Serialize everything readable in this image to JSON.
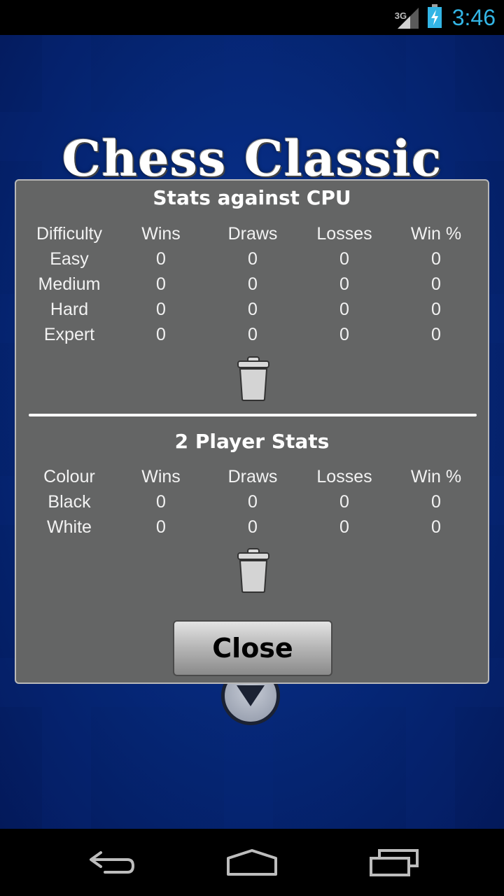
{
  "status_bar": {
    "network_type": "3G",
    "time": "3:46",
    "icons": [
      "signal-icon",
      "battery-charging-icon"
    ]
  },
  "app": {
    "title": "Chess Classic",
    "down_button_icon": "arrow-down-icon"
  },
  "dialog": {
    "cpu_section": {
      "title": "Stats against CPU",
      "headers": [
        "Difficulty",
        "Wins",
        "Draws",
        "Losses",
        "Win %"
      ],
      "rows": [
        [
          "Easy",
          "0",
          "0",
          "0",
          "0"
        ],
        [
          "Medium",
          "0",
          "0",
          "0",
          "0"
        ],
        [
          "Hard",
          "0",
          "0",
          "0",
          "0"
        ],
        [
          "Expert",
          "0",
          "0",
          "0",
          "0"
        ]
      ],
      "clear_icon": "trash-icon"
    },
    "two_player_section": {
      "title": "2 Player Stats",
      "headers": [
        "Colour",
        "Wins",
        "Draws",
        "Losses",
        "Win %"
      ],
      "rows": [
        [
          "Black",
          "0",
          "0",
          "0",
          "0"
        ],
        [
          "White",
          "0",
          "0",
          "0",
          "0"
        ]
      ],
      "clear_icon": "trash-icon"
    },
    "close_label": "Close"
  },
  "nav_bar": {
    "icons": [
      "back-icon",
      "home-icon",
      "recent-apps-icon"
    ]
  },
  "colors": {
    "clock": "#33b5e5",
    "dialog_bg": "#646565",
    "app_bg": "#062a7c"
  }
}
